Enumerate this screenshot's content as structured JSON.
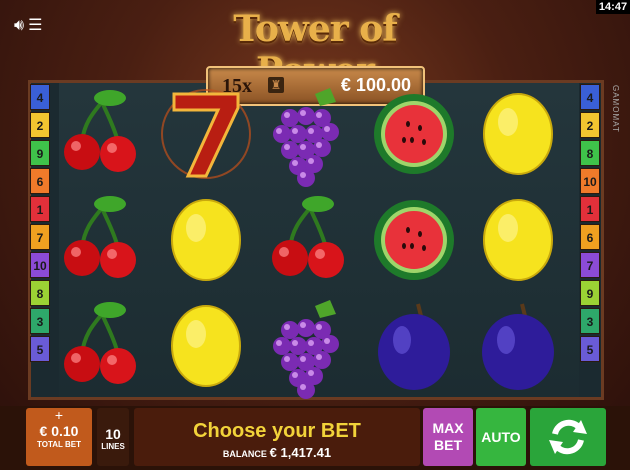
{
  "status": {
    "time": "14:47"
  },
  "game": {
    "logo": "Tower of Power"
  },
  "banner": {
    "multiplier": "15x",
    "jackpot": "€ 100.00"
  },
  "brand": {
    "vertical": "GAMOMAT"
  },
  "paylines_left": [
    "4",
    "2",
    "9",
    "6",
    "1",
    "7",
    "10",
    "8",
    "3",
    "5"
  ],
  "paylines_right": [
    "4",
    "2",
    "8",
    "10",
    "1",
    "6",
    "7",
    "9",
    "3",
    "5"
  ],
  "reels": [
    [
      "cherry",
      "cherry",
      "cherry"
    ],
    [
      "seven",
      "lemon",
      "lemon"
    ],
    [
      "grapes",
      "cherry",
      "grapes"
    ],
    [
      "watermelon",
      "watermelon",
      "plum"
    ],
    [
      "lemon",
      "lemon",
      "plum"
    ]
  ],
  "controls": {
    "bet_plus": "+",
    "bet_value": "€ 0.10",
    "bet_label": "TOTAL BET",
    "lines_value": "10",
    "lines_label": "LINES",
    "message": "Choose your BET",
    "balance_label": "BALANCE",
    "balance_value": "€ 1,417.41",
    "max_bet_line1": "MAX",
    "max_bet_line2": "BET",
    "auto": "AUTO"
  },
  "colors": {
    "line_colors": [
      "#3a5fd6",
      "#f2c530",
      "#3fc24a",
      "#f07a2a",
      "#e2303a",
      "#f0a020",
      "#8c4bd6",
      "#9bd234",
      "#2ea86a",
      "#6a5bd6"
    ]
  }
}
